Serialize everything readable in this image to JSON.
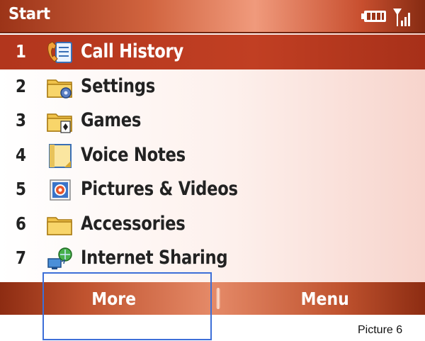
{
  "titlebar": {
    "title": "Start",
    "battery_icon": "battery-icon",
    "signal_icon": "signal-icon"
  },
  "menu": {
    "items": [
      {
        "number": "1",
        "label": "Call History",
        "icon": "call-history-icon",
        "selected": true
      },
      {
        "number": "2",
        "label": "Settings",
        "icon": "settings-folder-icon",
        "selected": false
      },
      {
        "number": "3",
        "label": "Games",
        "icon": "games-folder-icon",
        "selected": false
      },
      {
        "number": "4",
        "label": "Voice Notes",
        "icon": "voice-notes-icon",
        "selected": false
      },
      {
        "number": "5",
        "label": "Pictures & Videos",
        "icon": "pictures-videos-icon",
        "selected": false
      },
      {
        "number": "6",
        "label": "Accessories",
        "icon": "accessories-folder-icon",
        "selected": false
      },
      {
        "number": "7",
        "label": "Internet Sharing",
        "icon": "internet-sharing-icon",
        "selected": false
      }
    ]
  },
  "softkeys": {
    "left": "More",
    "right": "Menu"
  },
  "caption": "Picture 6",
  "colors": {
    "selection": "#b2361d",
    "titlebar": "#d1643f",
    "highlight_box": "#3d6fd8"
  }
}
